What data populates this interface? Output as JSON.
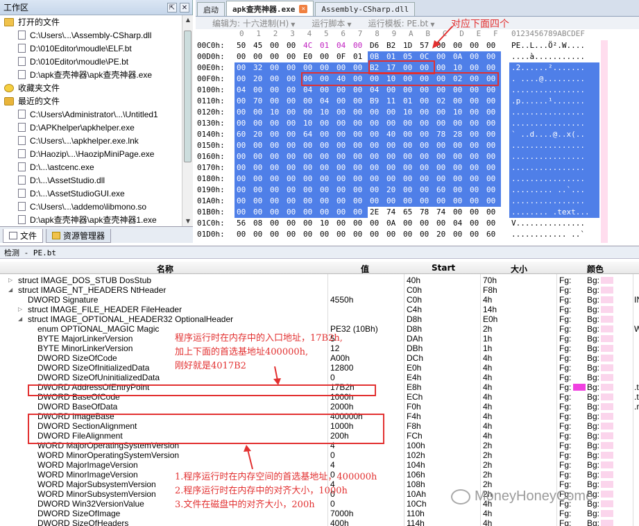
{
  "workspace": {
    "title": "工作区",
    "pin_icon": "pin-icon",
    "close_icon": "close-icon",
    "items": [
      {
        "kind": "cat",
        "label": "打开的文件"
      },
      {
        "kind": "file",
        "label": "C:\\Users\\...\\Assembly-CSharp.dll"
      },
      {
        "kind": "file",
        "label": "D:\\010Editor\\moudle\\ELF.bt"
      },
      {
        "kind": "file",
        "label": "D:\\010Editor\\moudle\\PE.bt"
      },
      {
        "kind": "file",
        "label": "D:\\apk查壳神器\\apk查壳神器.exe"
      },
      {
        "kind": "cat fav",
        "label": "收藏夹文件"
      },
      {
        "kind": "cat rec",
        "label": "最近的文件"
      },
      {
        "kind": "file",
        "label": "C:\\Users\\Administrator\\...\\Untitled1"
      },
      {
        "kind": "file",
        "label": "D:\\APKhelper\\apkhelper.exe"
      },
      {
        "kind": "file",
        "label": "C:\\Users\\...\\apkhelper.exe.lnk"
      },
      {
        "kind": "file",
        "label": "D:\\Haozip\\...\\HaozipMiniPage.exe"
      },
      {
        "kind": "file",
        "label": "D:\\...\\astcenc.exe"
      },
      {
        "kind": "file",
        "label": "D:\\...\\AssetStudio.dll"
      },
      {
        "kind": "file",
        "label": "D:\\...\\AssetStudioGUI.exe"
      },
      {
        "kind": "file",
        "label": "C:\\Users\\...\\addemo\\libmono.so"
      },
      {
        "kind": "file",
        "label": "D:\\apk查壳神器\\apk查壳神器1.exe"
      }
    ],
    "tabs": [
      {
        "label": "文件",
        "active": true
      },
      {
        "label": "资源管理器",
        "active": false
      }
    ]
  },
  "editor": {
    "tabs": [
      {
        "label": "启动",
        "active": false,
        "closable": false
      },
      {
        "label": "apk查壳神器.exe",
        "active": true,
        "closable": true
      },
      {
        "label": "Assembly-CSharp.dll",
        "active": false,
        "closable": false
      }
    ],
    "toolbar": {
      "edit_as": "编辑为: 十六进制(H)",
      "run_script": "运行脚本",
      "run_template": "运行模板: PE.bt"
    },
    "col_header": [
      "0",
      "1",
      "2",
      "3",
      "4",
      "5",
      "6",
      "7",
      "8",
      "9",
      "A",
      "B",
      "C",
      "D",
      "E",
      "F"
    ],
    "ascii_header": "0123456789ABCDEF",
    "rows": [
      {
        "addr": "00C0h:",
        "bytes": [
          "50",
          "45",
          "00",
          "00",
          "4C",
          "01",
          "04",
          "00",
          "D6",
          "B2",
          "1D",
          "57",
          "00",
          "00",
          "00",
          "00"
        ],
        "ascii": "PE..L...Ö².W....",
        "style": "w",
        "pk": [
          4,
          5,
          6,
          7
        ]
      },
      {
        "addr": "00D0h:",
        "bytes": [
          "00",
          "00",
          "00",
          "00",
          "E0",
          "00",
          "0F",
          "01",
          "0B",
          "01",
          "05",
          "0C",
          "00",
          "0A",
          "00",
          "00"
        ],
        "ascii": "....à...........",
        "style": "w",
        "blueFrom": 8
      },
      {
        "addr": "00E0h:",
        "bytes": [
          "00",
          "32",
          "00",
          "00",
          "00",
          "00",
          "00",
          "00",
          "B2",
          "17",
          "00",
          "00",
          "00",
          "10",
          "00",
          "00"
        ],
        "ascii": ".2......².......",
        "style": "b"
      },
      {
        "addr": "00F0h:",
        "bytes": [
          "00",
          "20",
          "00",
          "00",
          "00",
          "00",
          "40",
          "00",
          "00",
          "10",
          "00",
          "00",
          "00",
          "02",
          "00",
          "00"
        ],
        "ascii": ". ....@.........",
        "style": "b"
      },
      {
        "addr": "0100h:",
        "bytes": [
          "04",
          "00",
          "00",
          "00",
          "04",
          "00",
          "00",
          "00",
          "04",
          "00",
          "00",
          "00",
          "00",
          "00",
          "00",
          "00"
        ],
        "ascii": "................",
        "style": "b"
      },
      {
        "addr": "0110h:",
        "bytes": [
          "00",
          "70",
          "00",
          "00",
          "00",
          "04",
          "00",
          "00",
          "B9",
          "11",
          "01",
          "00",
          "02",
          "00",
          "00",
          "00"
        ],
        "ascii": ".p......¹.......",
        "style": "b"
      },
      {
        "addr": "0120h:",
        "bytes": [
          "00",
          "00",
          "10",
          "00",
          "00",
          "10",
          "00",
          "00",
          "00",
          "00",
          "10",
          "00",
          "00",
          "10",
          "00",
          "00"
        ],
        "ascii": "................",
        "style": "b"
      },
      {
        "addr": "0130h:",
        "bytes": [
          "00",
          "00",
          "00",
          "00",
          "10",
          "00",
          "00",
          "00",
          "00",
          "00",
          "00",
          "00",
          "00",
          "00",
          "00",
          "00"
        ],
        "ascii": "................",
        "style": "b"
      },
      {
        "addr": "0140h:",
        "bytes": [
          "60",
          "20",
          "00",
          "00",
          "64",
          "00",
          "00",
          "00",
          "00",
          "40",
          "00",
          "00",
          "78",
          "28",
          "00",
          "00"
        ],
        "ascii": "` ..d....@..x(..",
        "style": "b"
      },
      {
        "addr": "0150h:",
        "bytes": [
          "00",
          "00",
          "00",
          "00",
          "00",
          "00",
          "00",
          "00",
          "00",
          "00",
          "00",
          "00",
          "00",
          "00",
          "00",
          "00"
        ],
        "ascii": "................",
        "style": "b"
      },
      {
        "addr": "0160h:",
        "bytes": [
          "00",
          "00",
          "00",
          "00",
          "00",
          "00",
          "00",
          "00",
          "00",
          "00",
          "00",
          "00",
          "00",
          "00",
          "00",
          "00"
        ],
        "ascii": "................",
        "style": "b"
      },
      {
        "addr": "0170h:",
        "bytes": [
          "00",
          "00",
          "00",
          "00",
          "00",
          "00",
          "00",
          "00",
          "00",
          "00",
          "00",
          "00",
          "00",
          "00",
          "00",
          "00"
        ],
        "ascii": "................",
        "style": "b"
      },
      {
        "addr": "0180h:",
        "bytes": [
          "00",
          "00",
          "00",
          "00",
          "00",
          "00",
          "00",
          "00",
          "00",
          "00",
          "00",
          "00",
          "00",
          "00",
          "00",
          "00"
        ],
        "ascii": "................",
        "style": "b"
      },
      {
        "addr": "0190h:",
        "bytes": [
          "00",
          "00",
          "00",
          "00",
          "00",
          "00",
          "00",
          "00",
          "00",
          "20",
          "00",
          "00",
          "60",
          "00",
          "00",
          "00"
        ],
        "ascii": "......... ..`...",
        "style": "b"
      },
      {
        "addr": "01A0h:",
        "bytes": [
          "00",
          "00",
          "00",
          "00",
          "00",
          "00",
          "00",
          "00",
          "00",
          "00",
          "00",
          "00",
          "00",
          "00",
          "00",
          "00"
        ],
        "ascii": "................",
        "style": "b"
      },
      {
        "addr": "01B0h:",
        "bytes": [
          "00",
          "00",
          "00",
          "00",
          "00",
          "00",
          "00",
          "00",
          "2E",
          "74",
          "65",
          "78",
          "74",
          "00",
          "00",
          "00"
        ],
        "ascii": "........ .text...",
        "style": "b",
        "whiteFrom": 8
      },
      {
        "addr": "01C0h:",
        "bytes": [
          "56",
          "08",
          "00",
          "00",
          "00",
          "10",
          "00",
          "00",
          "00",
          "0A",
          "00",
          "00",
          "00",
          "04",
          "00",
          "00"
        ],
        "ascii": "V...............",
        "style": "w"
      },
      {
        "addr": "01D0h:",
        "bytes": [
          "00",
          "00",
          "00",
          "00",
          "00",
          "00",
          "00",
          "00",
          "00",
          "00",
          "00",
          "00",
          "20",
          "00",
          "00",
          "60"
        ],
        "ascii": "............ ..`",
        "style": "w"
      }
    ]
  },
  "inspector": {
    "title": "检测 - PE.bt",
    "columns": {
      "name": "名称",
      "value": "值",
      "start": "Start",
      "size": "大小",
      "color": "颜色"
    },
    "fg": "Fg:",
    "bg": "Bg:",
    "rows": [
      {
        "ind": 0,
        "tw": "▷",
        "name": "struct IMAGE_DOS_STUB DosStub",
        "value": "",
        "start": "40h",
        "size": "70h"
      },
      {
        "ind": 0,
        "tw": "◢",
        "name": "struct IMAGE_NT_HEADERS NtHeader",
        "value": "",
        "start": "C0h",
        "size": "F8h"
      },
      {
        "ind": 1,
        "tw": "",
        "name": "DWORD Signature",
        "value": "4550h",
        "start": "C0h",
        "size": "4h",
        "extra": "IN"
      },
      {
        "ind": 1,
        "tw": "▷",
        "name": "struct IMAGE_FILE_HEADER FileHeader",
        "value": "",
        "start": "C4h",
        "size": "14h"
      },
      {
        "ind": 1,
        "tw": "◢",
        "name": "struct IMAGE_OPTIONAL_HEADER32 OptionalHeader",
        "value": "",
        "start": "D8h",
        "size": "E0h"
      },
      {
        "ind": 2,
        "tw": "",
        "name": "enum OPTIONAL_MAGIC Magic",
        "value": "PE32 (10Bh)",
        "start": "D8h",
        "size": "2h",
        "extra": "W"
      },
      {
        "ind": 2,
        "tw": "",
        "name": "BYTE MajorLinkerVersion",
        "value": "5",
        "start": "DAh",
        "size": "1h"
      },
      {
        "ind": 2,
        "tw": "",
        "name": "BYTE MinorLinkerVersion",
        "value": "12",
        "start": "DBh",
        "size": "1h"
      },
      {
        "ind": 2,
        "tw": "",
        "name": "DWORD SizeOfCode",
        "value": "A00h",
        "start": "DCh",
        "size": "4h"
      },
      {
        "ind": 2,
        "tw": "",
        "name": "DWORD SizeOfInitializedData",
        "value": "12800",
        "start": "E0h",
        "size": "4h"
      },
      {
        "ind": 2,
        "tw": "",
        "name": "DWORD SizeOfUninitializedData",
        "value": "0",
        "start": "E4h",
        "size": "4h"
      },
      {
        "ind": 2,
        "tw": "",
        "name": "DWORD AddressOfEntryPoint",
        "value": "17B2h",
        "start": "E8h",
        "size": "4h",
        "fg": true,
        "extra": ".t"
      },
      {
        "ind": 2,
        "tw": "",
        "name": "DWORD BaseOfCode",
        "value": "1000h",
        "start": "ECh",
        "size": "4h",
        "extra": ".t"
      },
      {
        "ind": 2,
        "tw": "",
        "name": "DWORD BaseOfData",
        "value": "2000h",
        "start": "F0h",
        "size": "4h",
        "extra": ".r"
      },
      {
        "ind": 2,
        "tw": "",
        "name": "DWORD ImageBase",
        "value": "400000h",
        "start": "F4h",
        "size": "4h"
      },
      {
        "ind": 2,
        "tw": "",
        "name": "DWORD SectionAlignment",
        "value": "1000h",
        "start": "F8h",
        "size": "4h"
      },
      {
        "ind": 2,
        "tw": "",
        "name": "DWORD FileAlignment",
        "value": "200h",
        "start": "FCh",
        "size": "4h"
      },
      {
        "ind": 2,
        "tw": "",
        "name": "WORD MajorOperatingSystemVersion",
        "value": "4",
        "start": "100h",
        "size": "2h"
      },
      {
        "ind": 2,
        "tw": "",
        "name": "WORD MinorOperatingSystemVersion",
        "value": "0",
        "start": "102h",
        "size": "2h"
      },
      {
        "ind": 2,
        "tw": "",
        "name": "WORD MajorImageVersion",
        "value": "4",
        "start": "104h",
        "size": "2h"
      },
      {
        "ind": 2,
        "tw": "",
        "name": "WORD MinorImageVersion",
        "value": "0",
        "start": "106h",
        "size": "2h"
      },
      {
        "ind": 2,
        "tw": "",
        "name": "WORD MajorSubsystemVersion",
        "value": "4",
        "start": "108h",
        "size": "2h"
      },
      {
        "ind": 2,
        "tw": "",
        "name": "WORD MinorSubsystemVersion",
        "value": "0",
        "start": "10Ah",
        "size": "2h"
      },
      {
        "ind": 2,
        "tw": "",
        "name": "DWORD Win32VersionValue",
        "value": "0",
        "start": "10Ch",
        "size": "4h"
      },
      {
        "ind": 2,
        "tw": "",
        "name": "DWORD SizeOfImage",
        "value": "7000h",
        "start": "110h",
        "size": "4h"
      },
      {
        "ind": 2,
        "tw": "",
        "name": "DWORD SizeOfHeaders",
        "value": "400h",
        "start": "114h",
        "size": "4h"
      }
    ]
  },
  "annotations": {
    "top_note": "对应下面四个",
    "entry_note": [
      "程序运行时在内存中的入口地址，17B2h,",
      "加上下面的首选基地址400000h,",
      "刚好就是4017B2"
    ],
    "bottom_note": [
      "1.程序运行时在内存空间的首选基地址，400000h",
      "2.程序运行时在内存中的对齐大小，1000h",
      "3.文件在磁盘中的对齐大小，200h"
    ]
  },
  "watermark": "MoneyHoneyCome",
  "colors": {
    "selection": "#4f7fe8",
    "annotation": "#e23030",
    "magenta": "#c020c0",
    "bg_swatch": "#fbd5ec"
  }
}
